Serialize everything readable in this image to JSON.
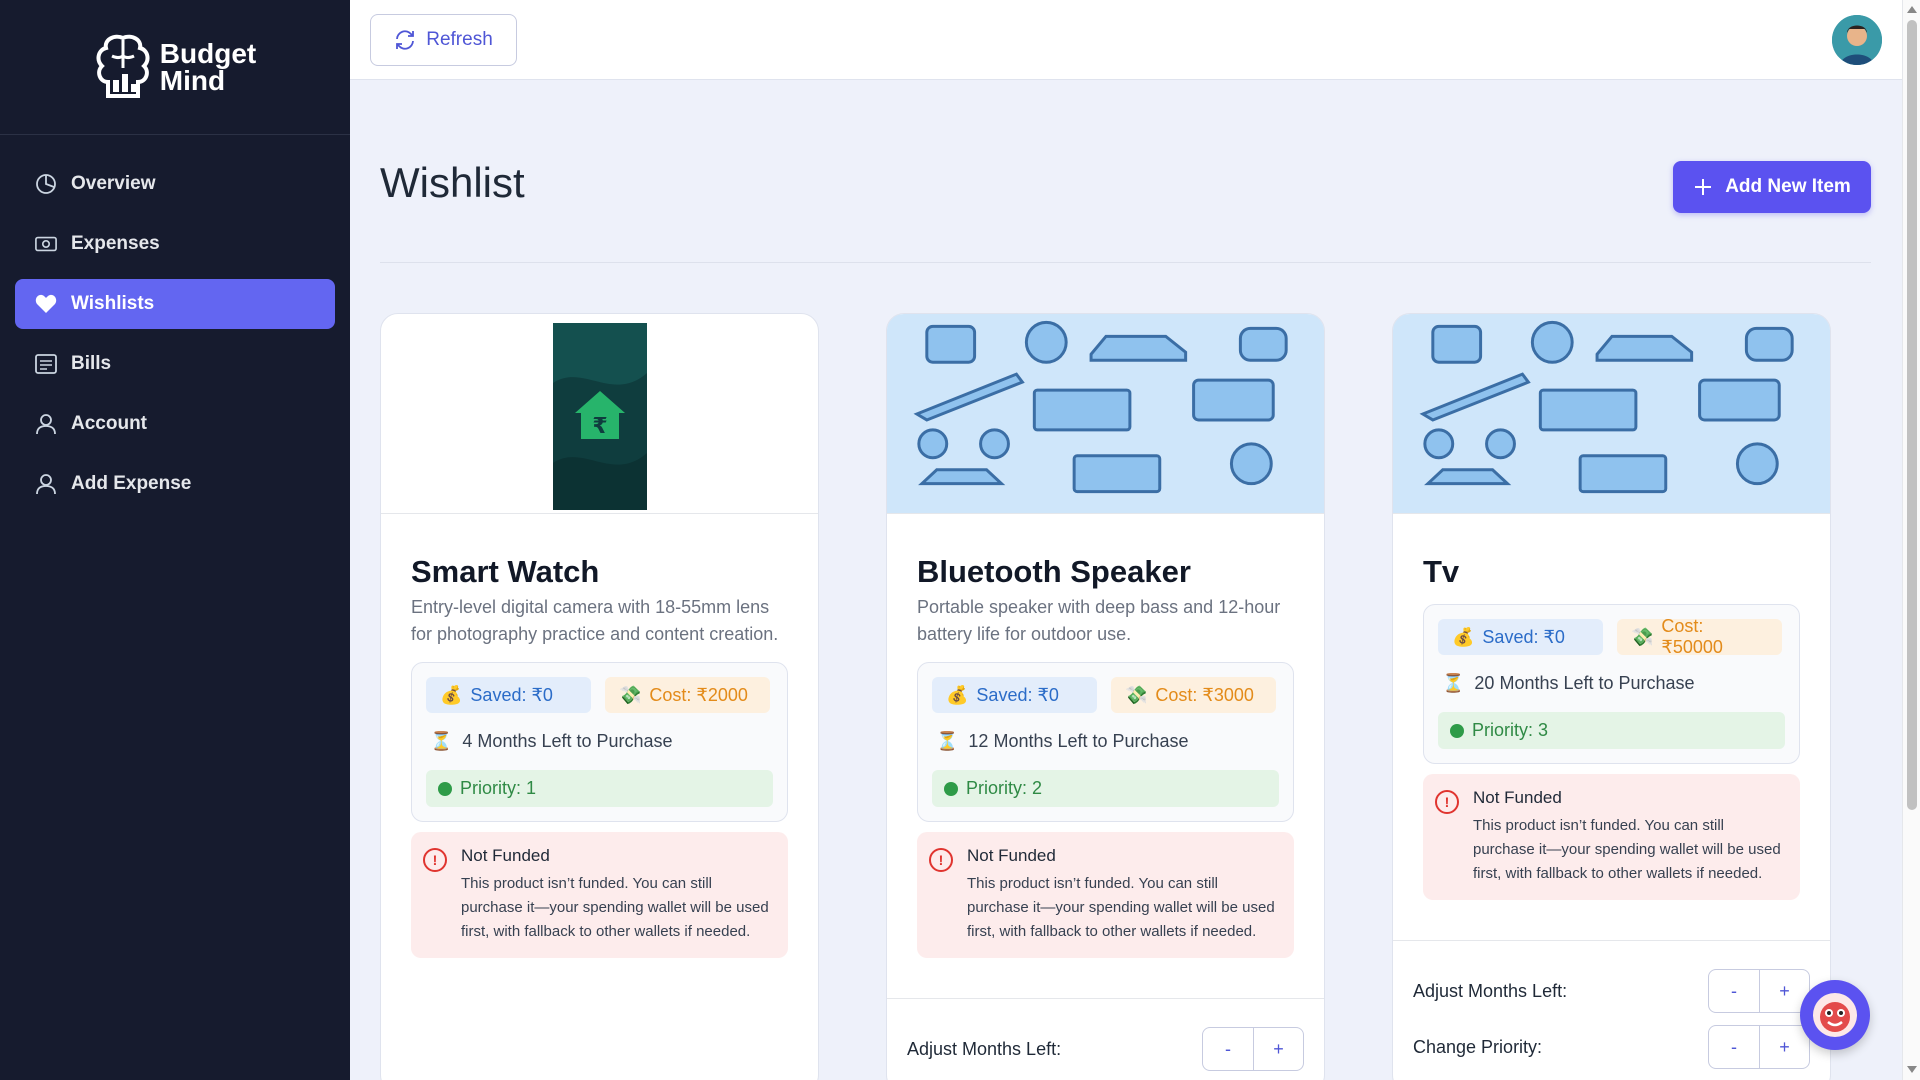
{
  "brand": {
    "line1": "Budget",
    "line2": "Mind"
  },
  "sidebar": {
    "items": [
      {
        "label": "Overview",
        "icon": "pie-chart-icon"
      },
      {
        "label": "Expenses",
        "icon": "cash-icon"
      },
      {
        "label": "Wishlists",
        "icon": "heart-icon",
        "active": true
      },
      {
        "label": "Bills",
        "icon": "receipt-icon"
      },
      {
        "label": "Account",
        "icon": "user-icon"
      },
      {
        "label": "Add Expense",
        "icon": "user-icon"
      }
    ]
  },
  "topbar": {
    "refresh_label": "Refresh"
  },
  "page": {
    "title": "Wishlist",
    "add_label": "Add New Item"
  },
  "cards": [
    {
      "title": "Smart Watch",
      "description": "Entry-level digital camera with 18-55mm lens for photography practice and content creation.",
      "saved": "Saved: ₹0",
      "cost": "Cost: ₹2000",
      "months": "4 Months Left to Purchase",
      "priority": "Priority: 1",
      "notice_title": "Not Funded",
      "notice_text": "This product isn’t funded. You can still purchase it—your spending wallet will be used first, with fallback to other wallets if needed."
    },
    {
      "title": "Bluetooth Speaker",
      "description": "Portable speaker with deep bass and 12-hour battery life for outdoor use.",
      "saved": "Saved: ₹0",
      "cost": "Cost: ₹3000",
      "months": "12 Months Left to Purchase",
      "priority": "Priority: 2",
      "notice_title": "Not Funded",
      "notice_text": "This product isn’t funded. You can still purchase it—your spending wallet will be used first, with fallback to other wallets if needed.",
      "adjust_label": "Adjust Months Left:"
    },
    {
      "title": "Tv",
      "description": "",
      "saved": "Saved: ₹0",
      "cost": "Cost: ₹50000",
      "months": "20 Months Left to Purchase",
      "priority": "Priority: 3",
      "notice_title": "Not Funded",
      "notice_text": "This product isn’t funded. You can still purchase it—your spending wallet will be used first, with fallback to other wallets if needed.",
      "adjust_label": "Adjust Months Left:",
      "priority_label": "Change Priority:"
    }
  ],
  "stepper": {
    "minus": "-",
    "plus": "+"
  },
  "colors": {
    "accent": "#5b52f0",
    "sidebar_bg": "#161b2e",
    "saved_text": "#2b6cc8",
    "cost_text": "#e38b1a",
    "priority_text": "#2f8a45",
    "notice_bg": "#fdecec"
  }
}
